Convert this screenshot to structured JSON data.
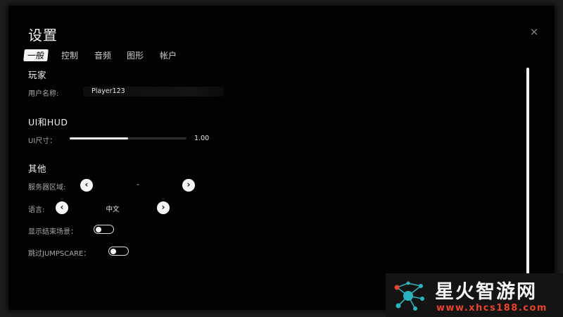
{
  "window": {
    "title": "设置",
    "close_label": "×"
  },
  "tabs": [
    {
      "label": "一般",
      "active": true
    },
    {
      "label": "控制",
      "active": false
    },
    {
      "label": "音频",
      "active": false
    },
    {
      "label": "图形",
      "active": false
    },
    {
      "label": "帐户",
      "active": false
    }
  ],
  "player": {
    "section_title": "玩家",
    "username_label": "用户名称:",
    "username_value": "Player123"
  },
  "ui_hud": {
    "section_title": "UI和HUD",
    "ui_size_label": "UI尺寸：",
    "ui_size_value": "1.00",
    "ui_size_fill_fraction": 0.5
  },
  "other": {
    "section_title": "其他",
    "server_region_label": "服务器区域:",
    "server_region_value": "-",
    "language_label": "语言:",
    "language_value": "中文",
    "show_end_scene_label": "显示结束场景：",
    "show_end_scene_on": false,
    "skip_jumpscare_label": "跳过JUMPSCARE：",
    "skip_jumpscare_on": false
  },
  "icons": {
    "prev": "chevron-left-icon",
    "next": "chevron-right-icon",
    "prev_glyph": "‹",
    "next_glyph": "›"
  },
  "watermark": {
    "title": "星火智游网",
    "url": "www.xhcs188.com",
    "url_color": "#e8442b",
    "logo_color": "#2bb3c0"
  }
}
